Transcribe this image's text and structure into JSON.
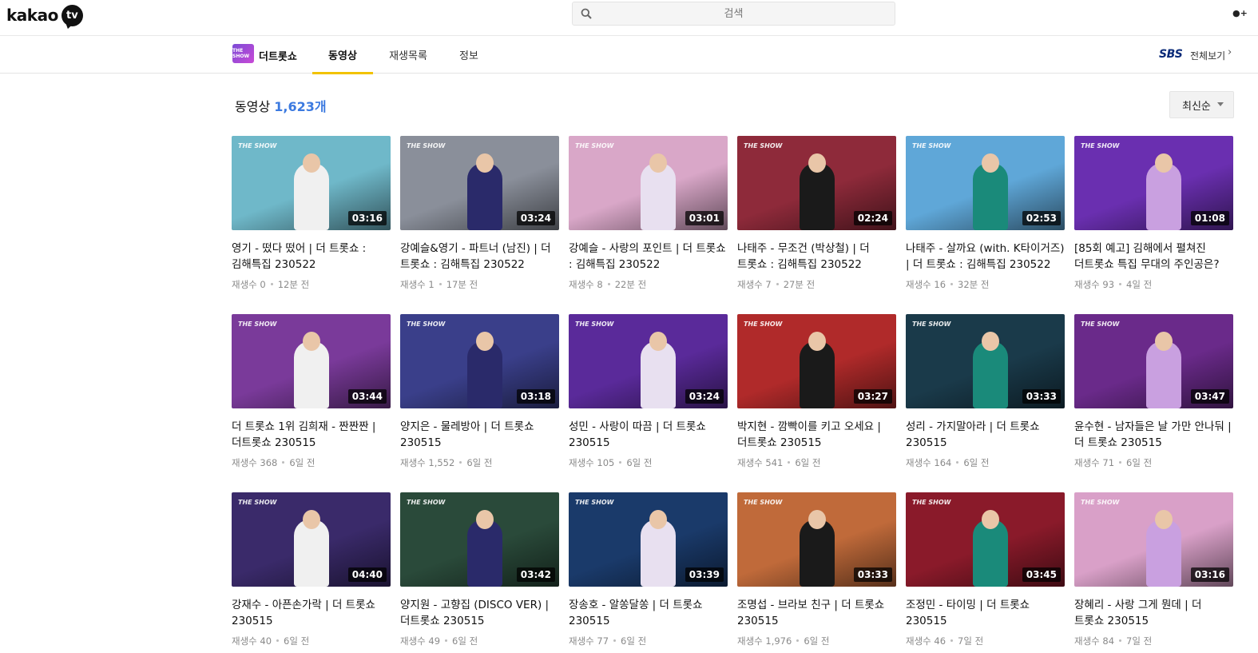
{
  "app": {
    "logo": "kakao",
    "logo_tv": "tv"
  },
  "search": {
    "placeholder": "검색"
  },
  "channel": {
    "name": "더트롯쇼",
    "logo_text": "THE SHOW",
    "broadcaster": "SBS",
    "view_all": "전체보기"
  },
  "tabs": [
    {
      "label": "동영상",
      "active": true
    },
    {
      "label": "재생목록",
      "active": false
    },
    {
      "label": "정보",
      "active": false
    }
  ],
  "section": {
    "title": "동영상",
    "count": "1,623개",
    "sort": "최신순"
  },
  "videos": [
    {
      "title": "영기 - 떴다 떴어 | 더 트롯쇼 : 김해특집 230522",
      "duration": "03:16",
      "views": "재생수 0",
      "time": "12분 전",
      "bg": "#6fb8c9"
    },
    {
      "title": "강예슬&영기 - 파트너 (남진) | 더 트롯쇼 : 김해특집 230522",
      "duration": "03:24",
      "views": "재생수 1",
      "time": "17분 전",
      "bg": "#8a8f9a"
    },
    {
      "title": "강예슬 - 사랑의 포인트 | 더 트롯쇼 : 김해특집 230522",
      "duration": "03:01",
      "views": "재생수 8",
      "time": "22분 전",
      "bg": "#d9a7c8"
    },
    {
      "title": "나태주 - 무조건 (박상철) | 더 트롯쇼 : 김해특집 230522",
      "duration": "02:24",
      "views": "재생수 7",
      "time": "27분 전",
      "bg": "#8e2a3a"
    },
    {
      "title": "나태주 - 살까요 (with. K타이거즈) | 더 트롯쇼 : 김해특집 230522",
      "duration": "02:53",
      "views": "재생수 16",
      "time": "32분 전",
      "bg": "#5fa7d8"
    },
    {
      "title": "[85회 예고] 김해에서 펼쳐진 더트롯쇼 특집 무대의 주인공은?",
      "duration": "01:08",
      "views": "재생수 93",
      "time": "4일 전",
      "bg": "#6a2fb0"
    },
    {
      "title": "더 트롯쇼 1위 김희재 - 짠짠짠 | 더트롯쇼 230515",
      "duration": "03:44",
      "views": "재생수 368",
      "time": "6일 전",
      "bg": "#7a3a9a"
    },
    {
      "title": "양지은 - 물레방아 | 더 트롯쇼 230515",
      "duration": "03:18",
      "views": "재생수 1,552",
      "time": "6일 전",
      "bg": "#3a3f8a"
    },
    {
      "title": "성민 - 사랑이 따끔 | 더 트롯쇼 230515",
      "duration": "03:24",
      "views": "재생수 105",
      "time": "6일 전",
      "bg": "#5a2a9a"
    },
    {
      "title": "박지현 - 깜빡이를 키고 오세요 | 더트롯쇼 230515",
      "duration": "03:27",
      "views": "재생수 541",
      "time": "6일 전",
      "bg": "#b02a2a"
    },
    {
      "title": "성리 - 가지말아라 | 더 트롯쇼 230515",
      "duration": "03:33",
      "views": "재생수 164",
      "time": "6일 전",
      "bg": "#1a3a4a"
    },
    {
      "title": "윤수현 - 남자들은 날 가만 안나둬 | 더 트롯쇼 230515",
      "duration": "03:47",
      "views": "재생수 71",
      "time": "6일 전",
      "bg": "#6a2a8a"
    },
    {
      "title": "강재수 - 아픈손가락 | 더 트롯쇼 230515",
      "duration": "04:40",
      "views": "재생수 40",
      "time": "6일 전",
      "bg": "#3a2a6a"
    },
    {
      "title": "양지원 - 고향집 (DISCO VER) | 더트롯쇼 230515",
      "duration": "03:42",
      "views": "재생수 49",
      "time": "6일 전",
      "bg": "#2a4a3a"
    },
    {
      "title": "장송호 - 알쏭달쏭 | 더 트롯쇼 230515",
      "duration": "03:39",
      "views": "재생수 77",
      "time": "6일 전",
      "bg": "#1a3a6a"
    },
    {
      "title": "조명섭 - 브라보 친구 | 더 트롯쇼 230515",
      "duration": "03:33",
      "views": "재생수 1,976",
      "time": "6일 전",
      "bg": "#c06a3a"
    },
    {
      "title": "조정민 - 타이밍 | 더 트롯쇼 230515",
      "duration": "03:45",
      "views": "재생수 46",
      "time": "7일 전",
      "bg": "#8a1a2a"
    },
    {
      "title": "장혜리 - 사랑 그게 뭔데 | 더 트롯쇼 230515",
      "duration": "03:16",
      "views": "재생수 84",
      "time": "7일 전",
      "bg": "#d9a0c8"
    }
  ]
}
